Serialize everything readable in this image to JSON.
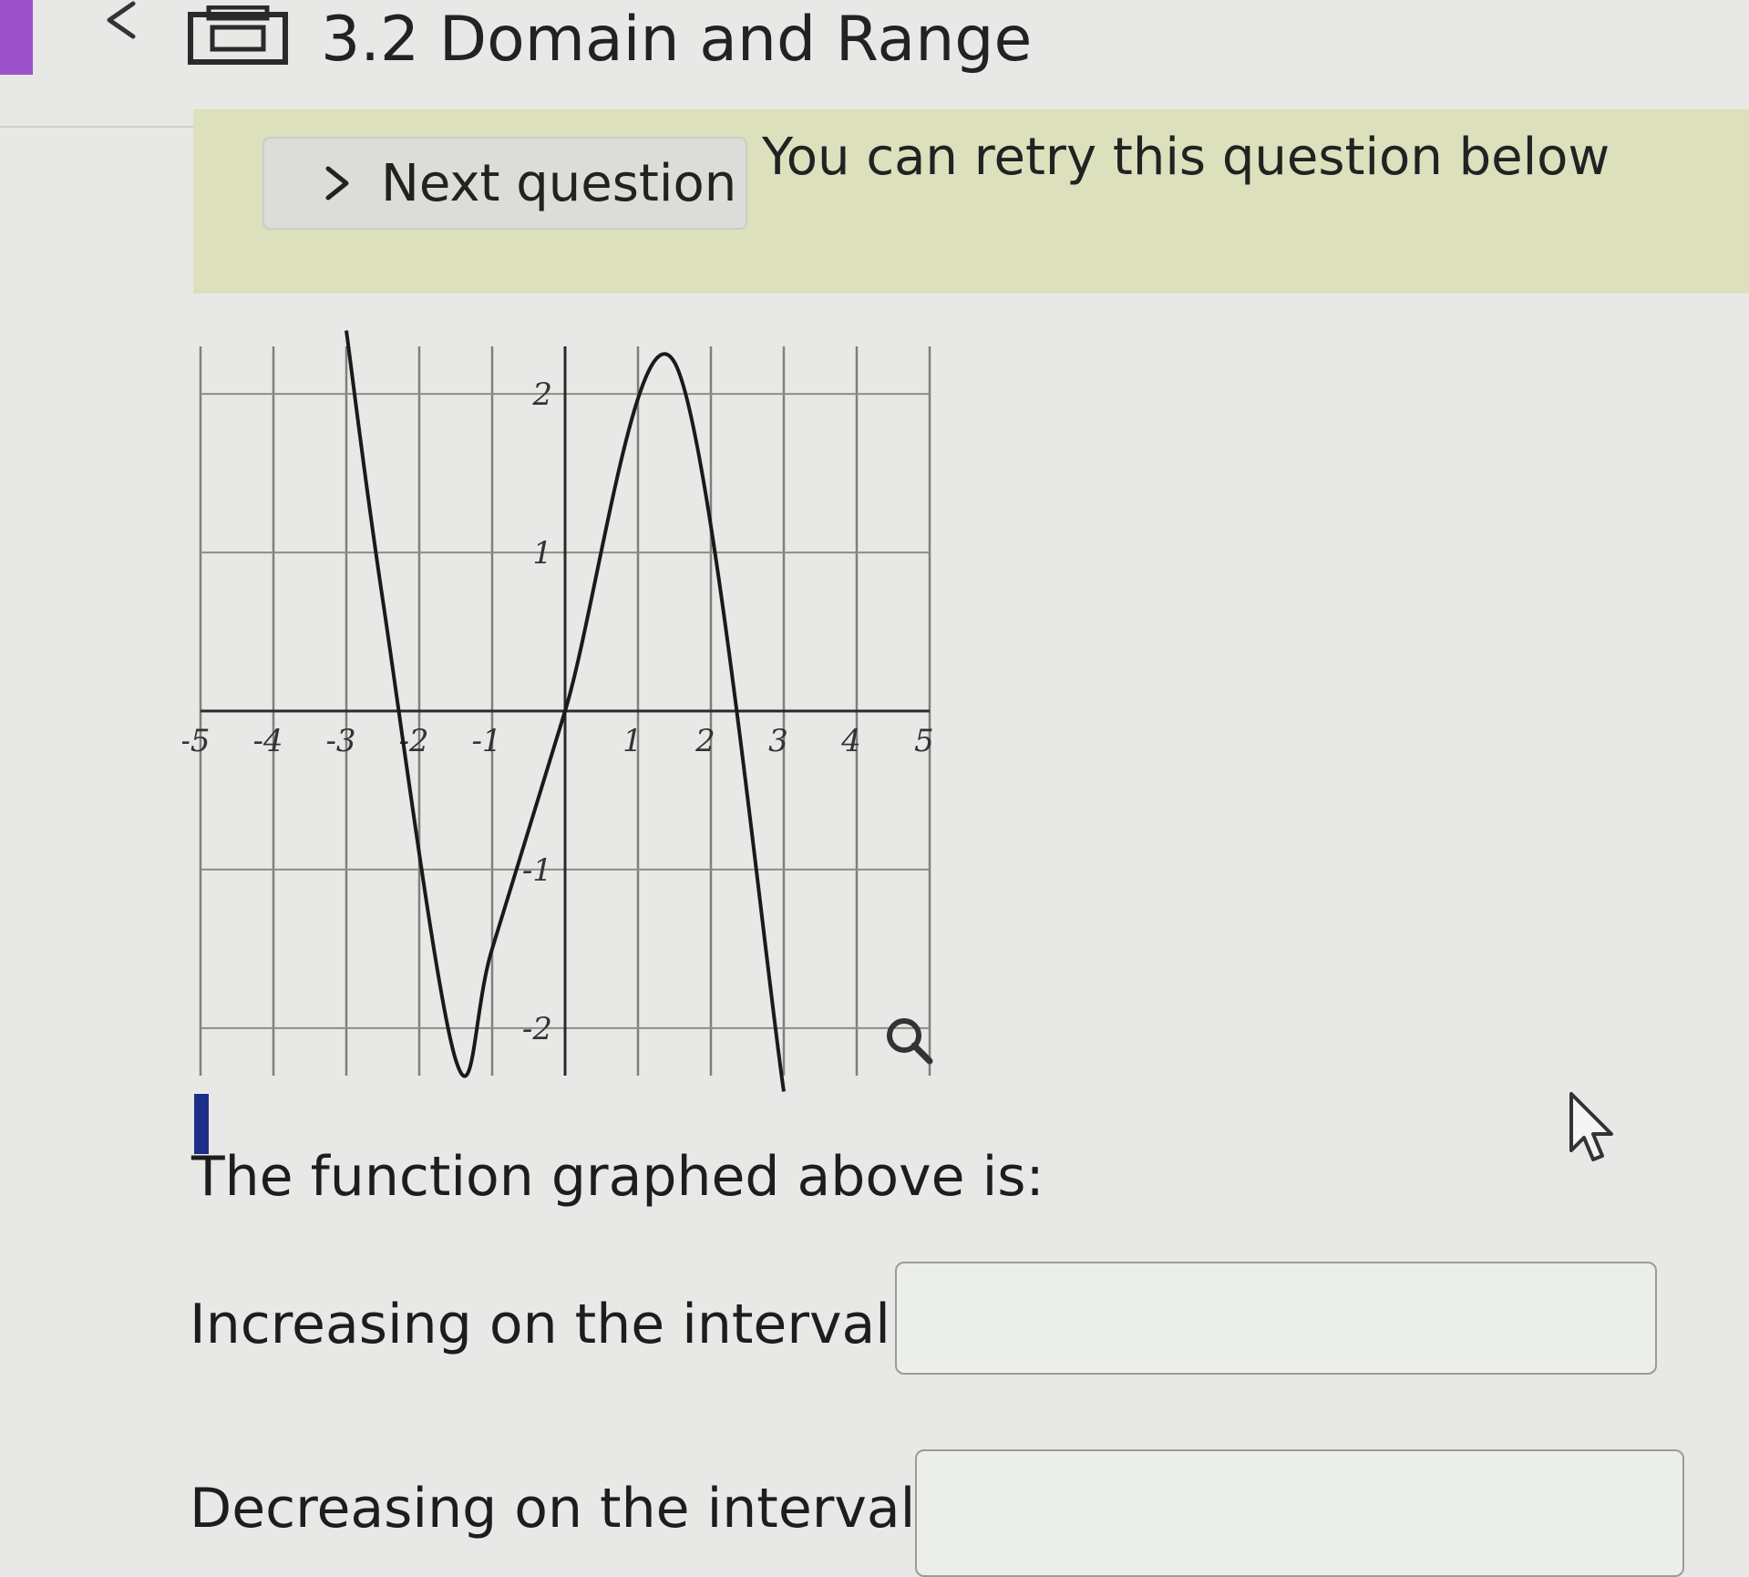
{
  "header": {
    "title": "3.2 Domain and Range"
  },
  "banner": {
    "next_label": "Next question",
    "retry_text": "You can retry this question below"
  },
  "question": {
    "prompt": "The function graphed above is:",
    "increasing_label": "Increasing on the interval(s)",
    "decreasing_label": "Decreasing on the interval(s)",
    "increasing_value": "",
    "decreasing_value": ""
  },
  "chart_data": {
    "type": "line",
    "title": "",
    "xlabel": "",
    "ylabel": "",
    "xlim": [
      -5,
      5
    ],
    "ylim": [
      -2.3,
      2.3
    ],
    "x_ticks": [
      -5,
      -4,
      -3,
      -2,
      -1,
      1,
      2,
      3,
      4,
      5
    ],
    "x_tick_labels": [
      "-5",
      "-4",
      "-3",
      "-2",
      "-1",
      "1",
      "2",
      "3",
      "4",
      "5"
    ],
    "y_ticks": [
      -2,
      -1,
      1,
      2
    ],
    "y_tick_labels": [
      "-2",
      "-1",
      "1",
      "2"
    ],
    "grid": true,
    "series": [
      {
        "x": [
          -3.0,
          -2.5,
          -1.5,
          -1.0,
          0.0,
          1.5,
          3.0
        ],
        "y": [
          2.4,
          0.7,
          -2.2,
          -1.5,
          0.0,
          2.2,
          -2.4
        ]
      }
    ]
  },
  "icons": {
    "back": "chevron-left-icon",
    "app": "document-tray-icon",
    "next": "chevron-right-icon",
    "zoom": "magnifier-icon",
    "cursor": "mouse-pointer-icon"
  },
  "colors": {
    "accent_purple": "#9b52c9",
    "banner_bg": "#dde0bc",
    "focus_bar": "#1b2f8a",
    "curve": "#1a1a1a"
  }
}
